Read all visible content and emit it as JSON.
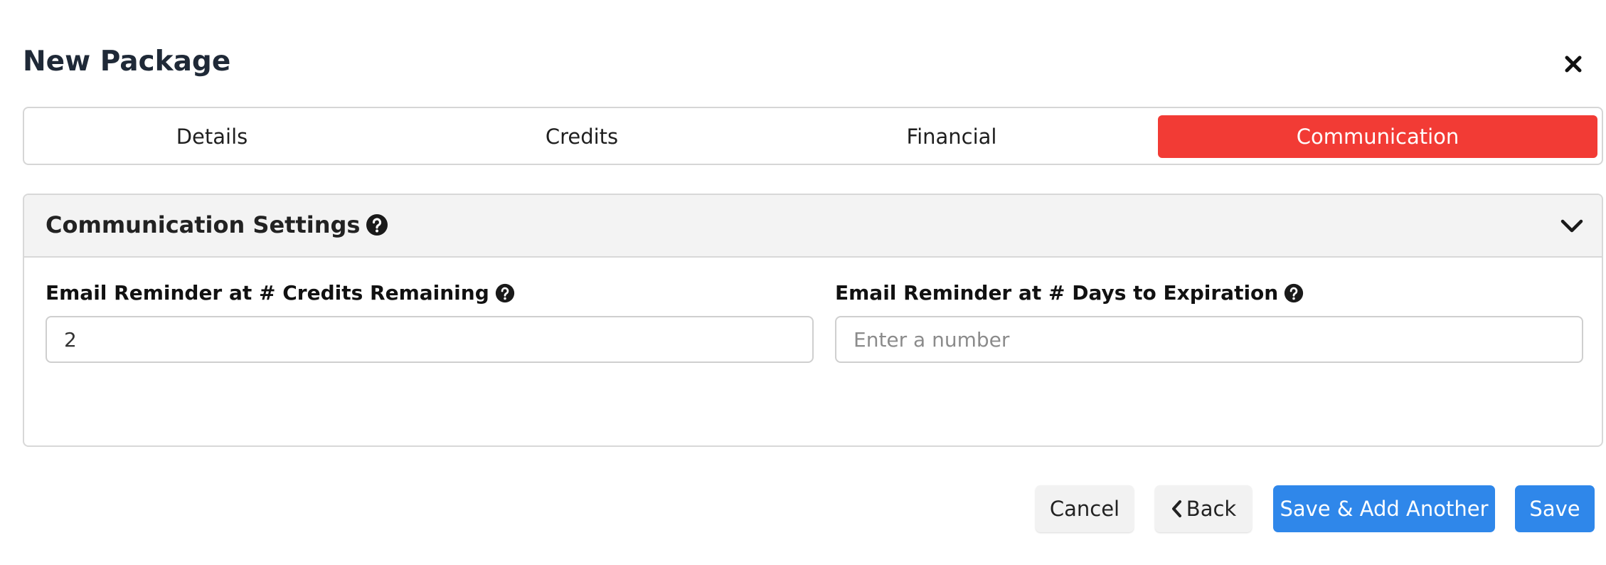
{
  "modal": {
    "title": "New Package",
    "close_icon": "close-icon"
  },
  "tabs": [
    {
      "label": "Details",
      "active": false
    },
    {
      "label": "Credits",
      "active": false
    },
    {
      "label": "Financial",
      "active": false
    },
    {
      "label": "Communication",
      "active": true
    }
  ],
  "section": {
    "title": "Communication Settings",
    "help_icon": "question-circle-icon",
    "collapse_icon": "chevron-down-icon",
    "fields": [
      {
        "label": "Email Reminder at # Credits Remaining",
        "value": "2",
        "placeholder": ""
      },
      {
        "label": "Email Reminder at # Days to Expiration",
        "value": "",
        "placeholder": "Enter a number"
      }
    ]
  },
  "footer": {
    "cancel_label": "Cancel",
    "back_label": "Back",
    "back_icon": "chevron-left-icon",
    "save_add_label": "Save & Add Another",
    "save_label": "Save"
  },
  "colors": {
    "active_tab": "#f23b35",
    "primary_button": "#2f87ea",
    "secondary_button": "#f2f2f2",
    "header_bg": "#f3f3f3"
  }
}
